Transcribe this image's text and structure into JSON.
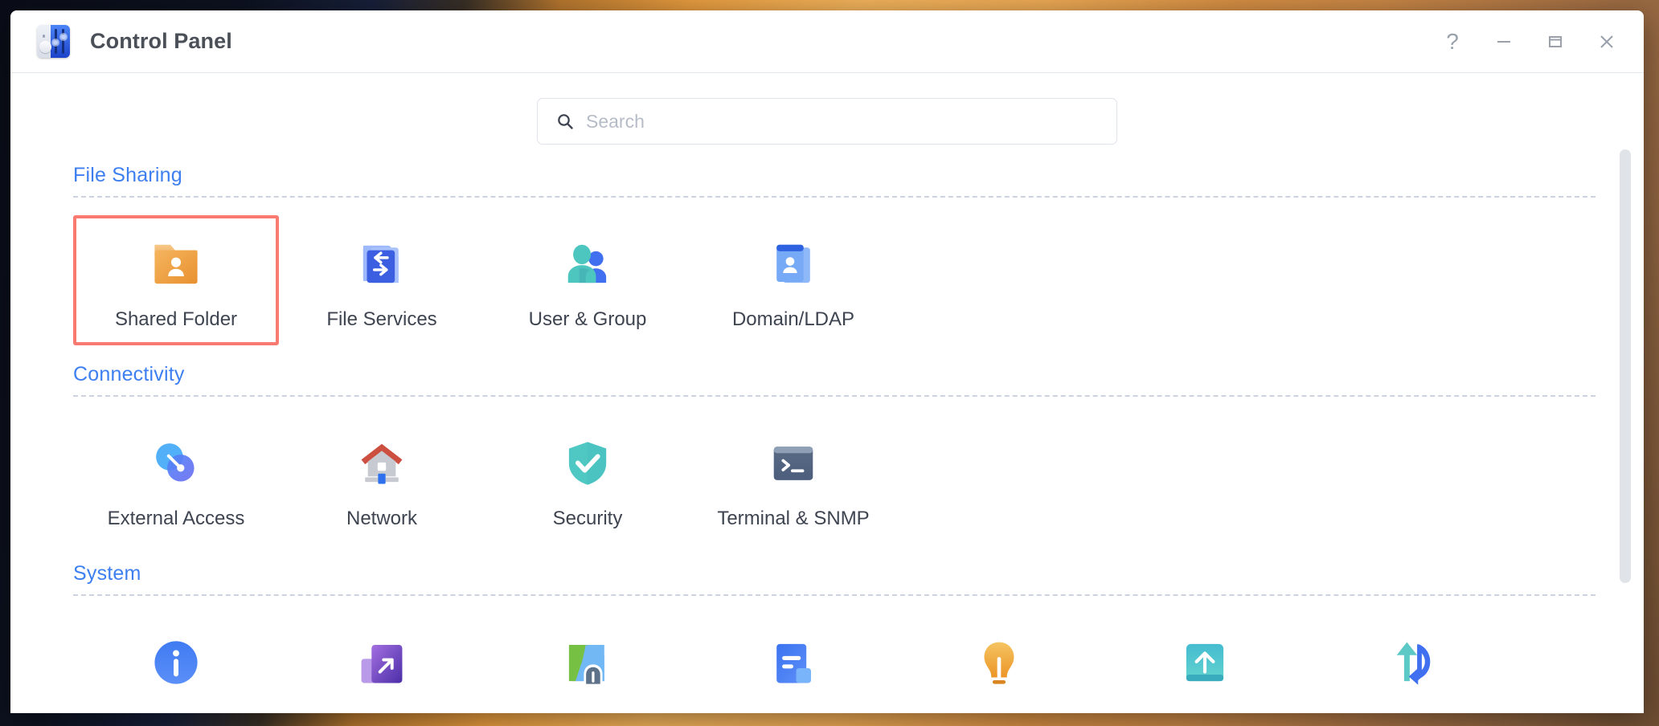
{
  "window": {
    "title": "Control Panel",
    "app_icon": "control-panel-icon",
    "controls": [
      {
        "name": "help-button",
        "glyph": "?"
      },
      {
        "name": "minimize-button",
        "glyph": "—"
      },
      {
        "name": "maximize-button",
        "glyph": "□"
      },
      {
        "name": "close-button",
        "glyph": "×"
      }
    ]
  },
  "search": {
    "placeholder": "Search",
    "value": "",
    "icon": "search-icon"
  },
  "colors": {
    "section_heading": "#3d7ff0",
    "selection_border": "#F97A70",
    "label_text": "#3e4450",
    "divider": "#ccd3de"
  },
  "sections": [
    {
      "title": "File Sharing",
      "tiles": [
        {
          "label": "Shared Folder",
          "icon": "shared-folder-icon",
          "selected": true
        },
        {
          "label": "File Services",
          "icon": "file-services-icon",
          "selected": false
        },
        {
          "label": "User & Group",
          "icon": "user-group-icon",
          "selected": false
        },
        {
          "label": "Domain/LDAP",
          "icon": "domain-ldap-icon",
          "selected": false
        }
      ]
    },
    {
      "title": "Connectivity",
      "tiles": [
        {
          "label": "External Access",
          "icon": "external-access-icon",
          "selected": false
        },
        {
          "label": "Network",
          "icon": "network-icon",
          "selected": false
        },
        {
          "label": "Security",
          "icon": "security-icon",
          "selected": false
        },
        {
          "label": "Terminal & SNMP",
          "icon": "terminal-snmp-icon",
          "selected": false
        }
      ]
    },
    {
      "title": "System",
      "tiles": [
        {
          "label": "",
          "icon": "info-center-icon",
          "selected": false
        },
        {
          "label": "",
          "icon": "external-devices-icon",
          "selected": false
        },
        {
          "label": "",
          "icon": "regional-options-icon",
          "selected": false
        },
        {
          "label": "",
          "icon": "task-scheduler-icon",
          "selected": false
        },
        {
          "label": "",
          "icon": "notification-icon",
          "selected": false
        },
        {
          "label": "",
          "icon": "update-restore-icon",
          "selected": false
        },
        {
          "label": "",
          "icon": "sync-backup-icon",
          "selected": false
        }
      ]
    }
  ],
  "scrollbar": {
    "name": "vertical-scrollbar"
  }
}
